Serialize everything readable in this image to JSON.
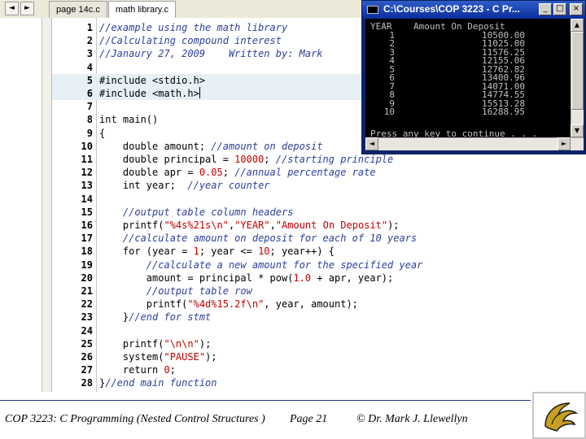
{
  "ide": {
    "nav_back": "◄",
    "nav_forward": "►",
    "tabs": [
      {
        "label": "page 14c.c",
        "active": false
      },
      {
        "label": "math library.c",
        "active": true
      }
    ],
    "code_lines": [
      {
        "n": "1",
        "segs": [
          {
            "t": "//example using the math library",
            "c": "cm"
          }
        ]
      },
      {
        "n": "2",
        "segs": [
          {
            "t": "//Calculating compound interest",
            "c": "cm"
          }
        ]
      },
      {
        "n": "3",
        "segs": [
          {
            "t": "//Janaury 27, 2009    Written by: Mark",
            "c": "cm"
          }
        ]
      },
      {
        "n": "4",
        "segs": []
      },
      {
        "n": "5",
        "pp": true,
        "segs": [
          {
            "t": "#include <stdio.h>",
            "c": ""
          }
        ]
      },
      {
        "n": "6",
        "pp": true,
        "caret": true,
        "segs": [
          {
            "t": "#include <math.h>",
            "c": ""
          }
        ]
      },
      {
        "n": "7",
        "segs": []
      },
      {
        "n": "8",
        "segs": [
          {
            "t": "int main()",
            "c": ""
          }
        ]
      },
      {
        "n": "9",
        "segs": [
          {
            "t": "{",
            "c": ""
          }
        ]
      },
      {
        "n": "10",
        "segs": [
          {
            "t": "    double amount; ",
            "c": ""
          },
          {
            "t": "//amount on deposit",
            "c": "cm"
          }
        ]
      },
      {
        "n": "11",
        "segs": [
          {
            "t": "    double principal = ",
            "c": ""
          },
          {
            "t": "10000",
            "c": "num"
          },
          {
            "t": "; ",
            "c": ""
          },
          {
            "t": "//starting principle",
            "c": "cm"
          }
        ]
      },
      {
        "n": "12",
        "segs": [
          {
            "t": "    double apr = ",
            "c": ""
          },
          {
            "t": "0.05",
            "c": "num"
          },
          {
            "t": "; ",
            "c": ""
          },
          {
            "t": "//annual percentage rate",
            "c": "cm"
          }
        ]
      },
      {
        "n": "13",
        "segs": [
          {
            "t": "    int year;  ",
            "c": ""
          },
          {
            "t": "//year counter",
            "c": "cm"
          }
        ]
      },
      {
        "n": "14",
        "segs": []
      },
      {
        "n": "15",
        "segs": [
          {
            "t": "    ",
            "c": ""
          },
          {
            "t": "//output table column headers",
            "c": "cm"
          }
        ]
      },
      {
        "n": "16",
        "segs": [
          {
            "t": "    printf(",
            "c": ""
          },
          {
            "t": "\"%4s%21s\\n\"",
            "c": "str"
          },
          {
            "t": ",",
            "c": ""
          },
          {
            "t": "\"YEAR\"",
            "c": "str"
          },
          {
            "t": ",",
            "c": ""
          },
          {
            "t": "\"Amount On Deposit\"",
            "c": "str"
          },
          {
            "t": ");",
            "c": ""
          }
        ]
      },
      {
        "n": "17",
        "segs": [
          {
            "t": "    ",
            "c": ""
          },
          {
            "t": "//calculate amount on deposit for each of 10 years",
            "c": "cm"
          }
        ]
      },
      {
        "n": "18",
        "segs": [
          {
            "t": "    for (year = ",
            "c": ""
          },
          {
            "t": "1",
            "c": "num"
          },
          {
            "t": "; year <= ",
            "c": ""
          },
          {
            "t": "10",
            "c": "num"
          },
          {
            "t": "; year++) {",
            "c": ""
          }
        ]
      },
      {
        "n": "19",
        "segs": [
          {
            "t": "        ",
            "c": ""
          },
          {
            "t": "//calculate a new amount for the specified year",
            "c": "cm"
          }
        ]
      },
      {
        "n": "20",
        "segs": [
          {
            "t": "        amount = principal * pow(",
            "c": ""
          },
          {
            "t": "1.0",
            "c": "num"
          },
          {
            "t": " + apr, year);",
            "c": ""
          }
        ]
      },
      {
        "n": "21",
        "segs": [
          {
            "t": "        ",
            "c": ""
          },
          {
            "t": "//output table row",
            "c": "cm"
          }
        ]
      },
      {
        "n": "22",
        "segs": [
          {
            "t": "        printf(",
            "c": ""
          },
          {
            "t": "\"%4d%15.2f\\n\"",
            "c": "str"
          },
          {
            "t": ", year, amount);",
            "c": ""
          }
        ]
      },
      {
        "n": "23",
        "segs": [
          {
            "t": "    }",
            "c": ""
          },
          {
            "t": "//end for stmt",
            "c": "cm"
          }
        ]
      },
      {
        "n": "24",
        "segs": []
      },
      {
        "n": "25",
        "segs": [
          {
            "t": "    printf(",
            "c": ""
          },
          {
            "t": "\"\\n\\n\"",
            "c": "str"
          },
          {
            "t": ");",
            "c": ""
          }
        ]
      },
      {
        "n": "26",
        "segs": [
          {
            "t": "    system(",
            "c": ""
          },
          {
            "t": "\"PAUSE\"",
            "c": "str"
          },
          {
            "t": ");",
            "c": ""
          }
        ]
      },
      {
        "n": "27",
        "segs": [
          {
            "t": "    return ",
            "c": ""
          },
          {
            "t": "0",
            "c": "num"
          },
          {
            "t": ";",
            "c": ""
          }
        ]
      },
      {
        "n": "28",
        "segs": [
          {
            "t": "}",
            "c": ""
          },
          {
            "t": "//end main function",
            "c": "cm"
          }
        ]
      }
    ]
  },
  "console": {
    "title": "C:\\Courses\\COP 3223 - C Pr...",
    "min_glyph": "_",
    "max_glyph": "□",
    "close_glyph": "×",
    "header": "YEAR    Amount On Deposit",
    "rows": [
      {
        "year": "1",
        "amount": "10500.00"
      },
      {
        "year": "2",
        "amount": "11025.00"
      },
      {
        "year": "3",
        "amount": "11576.25"
      },
      {
        "year": "4",
        "amount": "12155.06"
      },
      {
        "year": "5",
        "amount": "12762.82"
      },
      {
        "year": "6",
        "amount": "13400.96"
      },
      {
        "year": "7",
        "amount": "14071.00"
      },
      {
        "year": "8",
        "amount": "14774.55"
      },
      {
        "year": "9",
        "amount": "15513.28"
      },
      {
        "year": "10",
        "amount": "16288.95"
      }
    ],
    "prompt": "Press any key to continue . . .",
    "arrow_up": "▲",
    "arrow_down": "▼",
    "arrow_left": "◄",
    "arrow_right": "►"
  },
  "footer": {
    "course": "COP 3223: C Programming (Nested Control Structures )",
    "page": "Page 21",
    "author": "© Dr. Mark J. Llewellyn"
  },
  "colors": {
    "comment": "#2e3f9c",
    "string": "#c40000",
    "preprocessor_bg": "#e6f0f5",
    "title_bar": "#0a2d9c",
    "footer_rule": "#1a3b8c",
    "logo_gold": "#c8a020"
  }
}
